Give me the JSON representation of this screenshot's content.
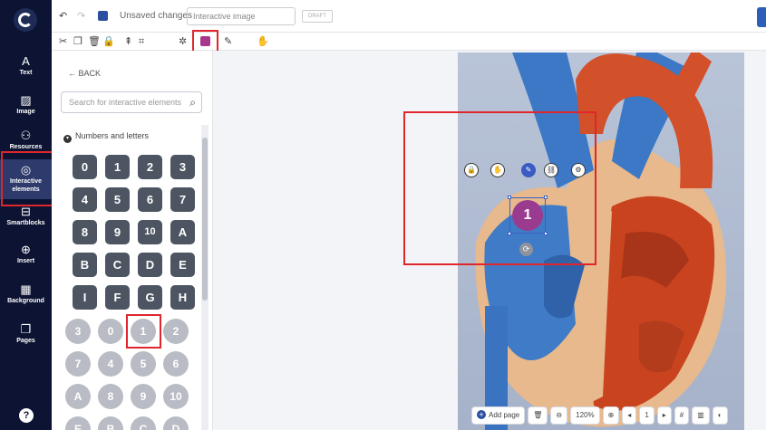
{
  "rail": {
    "items": [
      {
        "label": "Text",
        "icon": "A"
      },
      {
        "label": "Image",
        "icon": "▨"
      },
      {
        "label": "Resources",
        "icon": "⚇"
      },
      {
        "label": "Interactive elements",
        "icon": "◎"
      },
      {
        "label": "Smartblocks",
        "icon": "⊟"
      },
      {
        "label": "Insert",
        "icon": "⊕"
      },
      {
        "label": "Background",
        "icon": "▦"
      },
      {
        "label": "Pages",
        "icon": "❐"
      }
    ],
    "help_icon": "?"
  },
  "header": {
    "unsaved": "Unsaved changes",
    "title_value": "Interactive image",
    "draft": "DRAFT"
  },
  "panel": {
    "back": "← BACK",
    "search_placeholder": "Search for interactive elements",
    "section_title": "Numbers and letters",
    "dark_tiles": [
      "0",
      "1",
      "2",
      "3",
      "4",
      "5",
      "6",
      "7",
      "8",
      "9",
      "10",
      "A",
      "B",
      "C",
      "D",
      "E",
      "I",
      "F",
      "G",
      "H"
    ],
    "round_tiles": [
      "3",
      "0",
      "1",
      "2",
      "7",
      "4",
      "5",
      "6",
      "A",
      "8",
      "9",
      "10",
      "E",
      "B",
      "C",
      "D"
    ]
  },
  "canvas": {
    "selected_label": "1"
  },
  "bottom": {
    "add_page": "Add page",
    "zoom": "120%",
    "page": "1"
  },
  "colors": {
    "rail_bg": "#0d1433",
    "accent_blue": "#2d4fa0",
    "selected_purple": "#a8358e",
    "highlight_red": "#e0262c"
  }
}
